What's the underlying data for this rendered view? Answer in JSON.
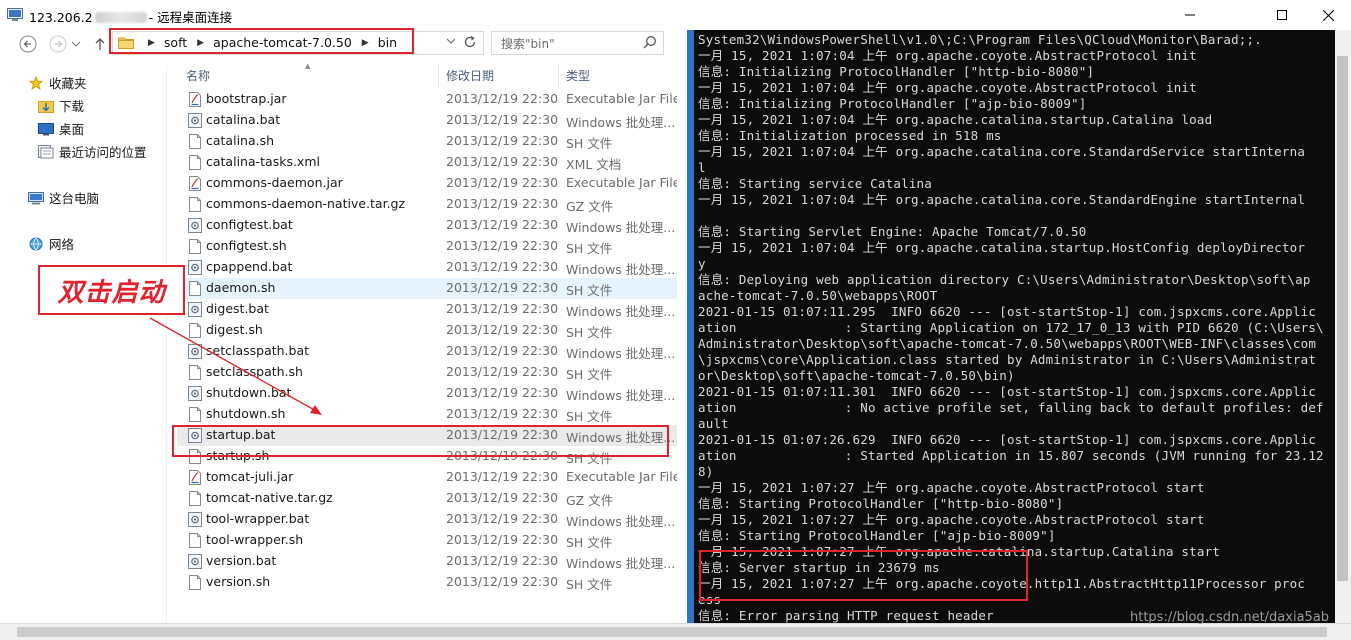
{
  "window": {
    "title_prefix": "123.206.2",
    "title_suffix": "- 远程桌面连接"
  },
  "explorer": {
    "breadcrumbs": [
      "soft",
      "apache-tomcat-7.0.50",
      "bin"
    ],
    "search_placeholder": "搜索\"bin\"",
    "nav": {
      "favorites": "收藏夹",
      "downloads": "下载",
      "desktop": "桌面",
      "recent": "最近访问的位置",
      "this_pc": "这台电脑",
      "network": "网络"
    },
    "columns": {
      "name": "名称",
      "date": "修改日期",
      "type": "类型"
    },
    "files": [
      {
        "name": "bootstrap.jar",
        "date": "2013/12/19 22:30",
        "type": "Executable Jar File",
        "icon": "jar-icon"
      },
      {
        "name": "catalina.bat",
        "date": "2013/12/19 22:30",
        "type": "Windows 批处理...",
        "icon": "bat-icon"
      },
      {
        "name": "catalina.sh",
        "date": "2013/12/19 22:30",
        "type": "SH 文件",
        "icon": "file-icon"
      },
      {
        "name": "catalina-tasks.xml",
        "date": "2013/12/19 22:30",
        "type": "XML 文档",
        "icon": "file-icon"
      },
      {
        "name": "commons-daemon.jar",
        "date": "2013/12/19 22:30",
        "type": "Executable Jar File",
        "icon": "jar-icon"
      },
      {
        "name": "commons-daemon-native.tar.gz",
        "date": "2013/12/19 22:30",
        "type": "GZ 文件",
        "icon": "file-icon"
      },
      {
        "name": "configtest.bat",
        "date": "2013/12/19 22:30",
        "type": "Windows 批处理...",
        "icon": "bat-icon"
      },
      {
        "name": "configtest.sh",
        "date": "2013/12/19 22:30",
        "type": "SH 文件",
        "icon": "file-icon"
      },
      {
        "name": "cpappend.bat",
        "date": "2013/12/19 22:30",
        "type": "Windows 批处理...",
        "icon": "bat-icon"
      },
      {
        "name": "daemon.sh",
        "date": "2013/12/19 22:30",
        "type": "SH 文件",
        "icon": "file-icon"
      },
      {
        "name": "digest.bat",
        "date": "2013/12/19 22:30",
        "type": "Windows 批处理...",
        "icon": "bat-icon"
      },
      {
        "name": "digest.sh",
        "date": "2013/12/19 22:30",
        "type": "SH 文件",
        "icon": "file-icon"
      },
      {
        "name": "setclasspath.bat",
        "date": "2013/12/19 22:30",
        "type": "Windows 批处理...",
        "icon": "bat-icon"
      },
      {
        "name": "setclasspath.sh",
        "date": "2013/12/19 22:30",
        "type": "SH 文件",
        "icon": "file-icon"
      },
      {
        "name": "shutdown.bat",
        "date": "2013/12/19 22:30",
        "type": "Windows 批处理...",
        "icon": "bat-icon"
      },
      {
        "name": "shutdown.sh",
        "date": "2013/12/19 22:30",
        "type": "SH 文件",
        "icon": "file-icon"
      },
      {
        "name": "startup.bat",
        "date": "2013/12/19 22:30",
        "type": "Windows 批处理...",
        "icon": "bat-icon"
      },
      {
        "name": "startup.sh",
        "date": "2013/12/19 22:30",
        "type": "SH 文件",
        "icon": "file-icon"
      },
      {
        "name": "tomcat-juli.jar",
        "date": "2013/12/19 22:30",
        "type": "Executable Jar File",
        "icon": "jar-icon"
      },
      {
        "name": "tomcat-native.tar.gz",
        "date": "2013/12/19 22:30",
        "type": "GZ 文件",
        "icon": "file-icon"
      },
      {
        "name": "tool-wrapper.bat",
        "date": "2013/12/19 22:30",
        "type": "Windows 批处理...",
        "icon": "bat-icon"
      },
      {
        "name": "tool-wrapper.sh",
        "date": "2013/12/19 22:30",
        "type": "SH 文件",
        "icon": "file-icon"
      },
      {
        "name": "version.bat",
        "date": "2013/12/19 22:30",
        "type": "Windows 批处理...",
        "icon": "bat-icon"
      },
      {
        "name": "version.sh",
        "date": "2013/12/19 22:30",
        "type": "SH 文件",
        "icon": "file-icon"
      }
    ],
    "hover_row": "daemon.sh",
    "selected_row": "startup.bat"
  },
  "annotation": {
    "label": "双击启动",
    "color": "#e0232d"
  },
  "console": {
    "lines": [
      "System32\\WindowsPowerShell\\v1.0\\;C:\\Program Files\\QCloud\\Monitor\\Barad;;.",
      "一月 15, 2021 1:07:04 上午 org.apache.coyote.AbstractProtocol init",
      "信息: Initializing ProtocolHandler [\"http-bio-8080\"]",
      "一月 15, 2021 1:07:04 上午 org.apache.coyote.AbstractProtocol init",
      "信息: Initializing ProtocolHandler [\"ajp-bio-8009\"]",
      "一月 15, 2021 1:07:04 上午 org.apache.catalina.startup.Catalina load",
      "信息: Initialization processed in 518 ms",
      "一月 15, 2021 1:07:04 上午 org.apache.catalina.core.StandardService startInterna",
      "l",
      "信息: Starting service Catalina",
      "一月 15, 2021 1:07:04 上午 org.apache.catalina.core.StandardEngine startInternal",
      "",
      "信息: Starting Servlet Engine: Apache Tomcat/7.0.50",
      "一月 15, 2021 1:07:04 上午 org.apache.catalina.startup.HostConfig deployDirector",
      "y",
      "信息: Deploying web application directory C:\\Users\\Administrator\\Desktop\\soft\\ap",
      "ache-tomcat-7.0.50\\webapps\\ROOT",
      "2021-01-15 01:07:11.295  INFO 6620 --- [ost-startStop-1] com.jspxcms.core.Applic",
      "ation              : Starting Application on 172_17_0_13 with PID 6620 (C:\\Users\\",
      "Administrator\\Desktop\\soft\\apache-tomcat-7.0.50\\webapps\\ROOT\\WEB-INF\\classes\\com",
      "\\jspxcms\\core\\Application.class started by Administrator in C:\\Users\\Administrat",
      "or\\Desktop\\soft\\apache-tomcat-7.0.50\\bin)",
      "2021-01-15 01:07:11.301  INFO 6620 --- [ost-startStop-1] com.jspxcms.core.Applic",
      "ation              : No active profile set, falling back to default profiles: def",
      "ault",
      "2021-01-15 01:07:26.629  INFO 6620 --- [ost-startStop-1] com.jspxcms.core.Applic",
      "ation              : Started Application in 15.807 seconds (JVM running for 23.12",
      "8)",
      "一月 15, 2021 1:07:27 上午 org.apache.coyote.AbstractProtocol start",
      "信息: Starting ProtocolHandler [\"http-bio-8080\"]",
      "一月 15, 2021 1:07:27 上午 org.apache.coyote.AbstractProtocol start",
      "信息: Starting ProtocolHandler [\"ajp-bio-8009\"]",
      "一月 15, 2021 1:07:27 上午 org.apache.catalina.startup.Catalina start",
      "信息: Server startup in 23679 ms",
      "一月 15, 2021 1:07:27 上午 org.apache.coyote.http11.AbstractHttp11Processor proc",
      "ess",
      "信息: Error parsing HTTP request header"
    ]
  },
  "watermark": "https://blog.csdn.net/daxia5ab"
}
